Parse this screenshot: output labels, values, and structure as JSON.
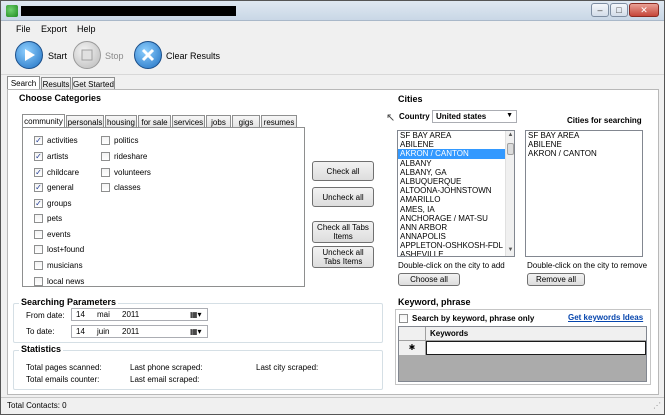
{
  "menu": {
    "file": "File",
    "export": "Export",
    "help": "Help"
  },
  "toolbar": {
    "start": "Start",
    "stop": "Stop",
    "clear": "Clear Results"
  },
  "main_tabs": [
    "Search",
    "Results",
    "Get Started"
  ],
  "categories": {
    "title": "Choose Categories",
    "tabs": [
      "community",
      "personals",
      "housing",
      "for sale",
      "services",
      "jobs",
      "gigs",
      "resumes"
    ],
    "col1": [
      {
        "label": "activities",
        "checked": true
      },
      {
        "label": "artists",
        "checked": true
      },
      {
        "label": "childcare",
        "checked": true
      },
      {
        "label": "general",
        "checked": true
      },
      {
        "label": "groups",
        "checked": true
      },
      {
        "label": "pets",
        "checked": false
      },
      {
        "label": "events",
        "checked": false
      },
      {
        "label": "lost+found",
        "checked": false
      },
      {
        "label": "musicians",
        "checked": false
      },
      {
        "label": "local news",
        "checked": false
      }
    ],
    "col2": [
      {
        "label": "politics",
        "checked": false
      },
      {
        "label": "rideshare",
        "checked": false
      },
      {
        "label": "volunteers",
        "checked": false
      },
      {
        "label": "classes",
        "checked": false
      }
    ],
    "buttons": {
      "check_all": "Check all",
      "uncheck_all": "Uncheck all",
      "check_all_tabs": "Check all Tabs Items",
      "uncheck_all_tabs": "Uncheck all Tabs Items"
    }
  },
  "params": {
    "title": "Searching Parameters",
    "from_label": "From date:",
    "from": {
      "day": "14",
      "month": "mai",
      "year": "2011"
    },
    "to_label": "To date:",
    "to": {
      "day": "14",
      "month": "juin",
      "year": "2011"
    }
  },
  "stats": {
    "title": "Statistics",
    "pages": "Total pages scanned:",
    "emails": "Total emails counter:",
    "last_phone": "Last phone scraped:",
    "last_email": "Last email scraped:",
    "last_city": "Last city scraped:"
  },
  "cities": {
    "title": "Cities",
    "country_label": "Country",
    "country": "United states",
    "for_search_title": "Cities for searching",
    "list": [
      "SF BAY AREA",
      "ABILENE",
      "AKRON / CANTON",
      "ALBANY",
      "ALBANY, GA",
      "ALBUQUERQUE",
      "ALTOONA-JOHNSTOWN",
      "AMARILLO",
      "AMES, IA",
      "ANCHORAGE / MAT-SU",
      "ANN ARBOR",
      "ANNAPOLIS",
      "APPLETON-OSHKOSH-FDL",
      "ASHEVILLE"
    ],
    "selected_index": 2,
    "for_search": [
      "SF BAY AREA",
      "ABILENE",
      "AKRON / CANTON"
    ],
    "hint_add": "Double-click on the city to add",
    "hint_remove": "Double-click on the city to remove",
    "choose_all": "Choose all",
    "remove_all": "Remove all"
  },
  "keyword": {
    "title": "Keyword, phrase",
    "checkbox_label": "Search by keyword, phrase only",
    "link": "Get keywords Ideas",
    "column": "Keywords",
    "new_row_marker": "✱"
  },
  "status": {
    "total_contacts": "Total Contacts: 0"
  }
}
